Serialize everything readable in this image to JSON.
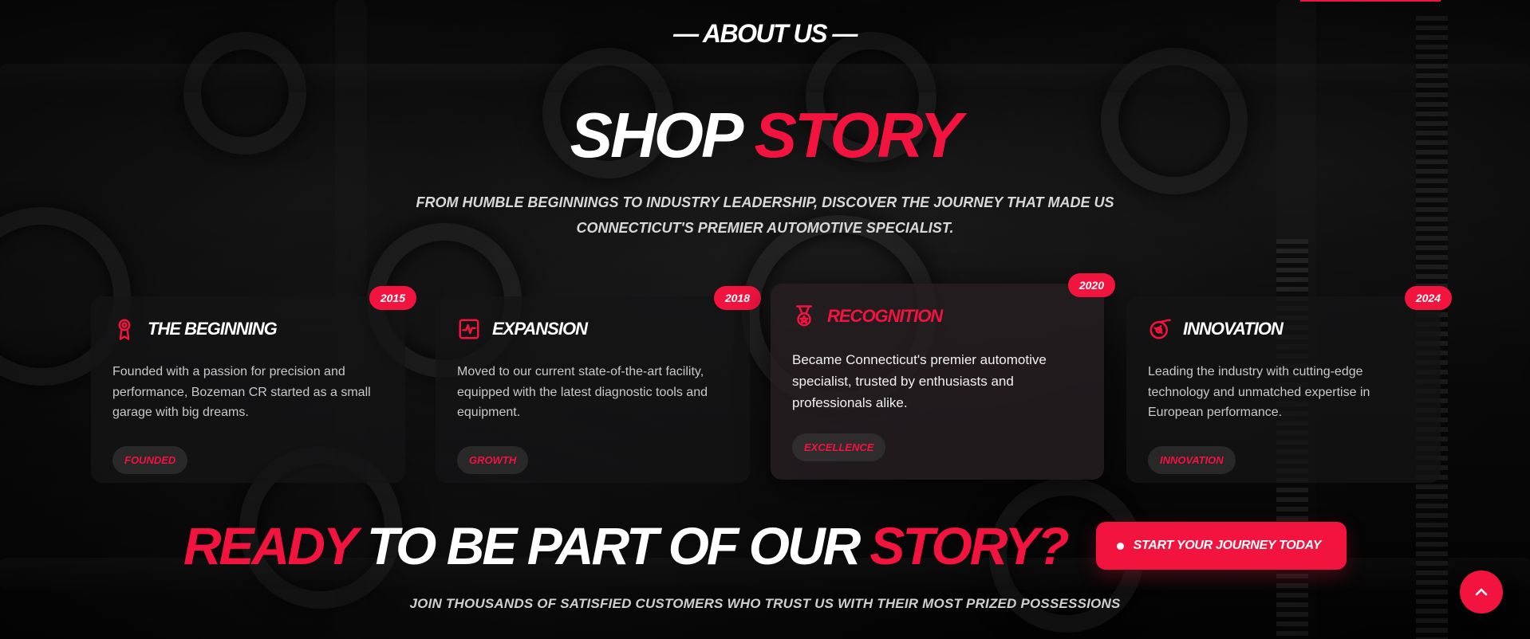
{
  "colors": {
    "accent": "#f2143f",
    "background": "#060606",
    "card": "#141416"
  },
  "section": {
    "eyebrow": "— ABOUT US —",
    "title_white": "SHOP",
    "title_accent": "STORY",
    "subtitle": "FROM HUMBLE BEGINNINGS TO INDUSTRY LEADERSHIP, DISCOVER THE JOURNEY THAT MADE US CONNECTICUT'S PREMIER AUTOMOTIVE SPECIALIST."
  },
  "timeline": [
    {
      "year": "2015",
      "icon": "award-ribbon-icon",
      "title": "THE BEGINNING",
      "text": "Founded with a passion for precision and performance, Bozeman CR started as a small garage with big dreams.",
      "tag": "FOUNDED"
    },
    {
      "year": "2018",
      "icon": "activity-chart-icon",
      "title": "EXPANSION",
      "text": "Moved to our current state-of-the-art facility, equipped with the latest diagnostic tools and equipment.",
      "tag": "GROWTH"
    },
    {
      "year": "2020",
      "icon": "medal-icon",
      "title": "RECOGNITION",
      "text": "Became Connecticut's premier automotive specialist, trusted by enthusiasts and professionals alike.",
      "tag": "EXCELLENCE"
    },
    {
      "year": "2024",
      "icon": "turbo-icon",
      "title": "INNOVATION",
      "text": "Leading the industry with cutting-edge technology and unmatched expertise in European performance.",
      "tag": "INNOVATION"
    }
  ],
  "cta": {
    "word_ready": "READY",
    "word_middle": "TO BE PART OF OUR",
    "word_story": "STORY?",
    "button_label": "START YOUR JOURNEY TODAY",
    "subtext": "JOIN THOUSANDS OF SATISFIED CUSTOMERS WHO TRUST US WITH THEIR MOST PRIZED POSSESSIONS"
  },
  "scroll_top": {
    "icon": "chevron-up-icon"
  }
}
